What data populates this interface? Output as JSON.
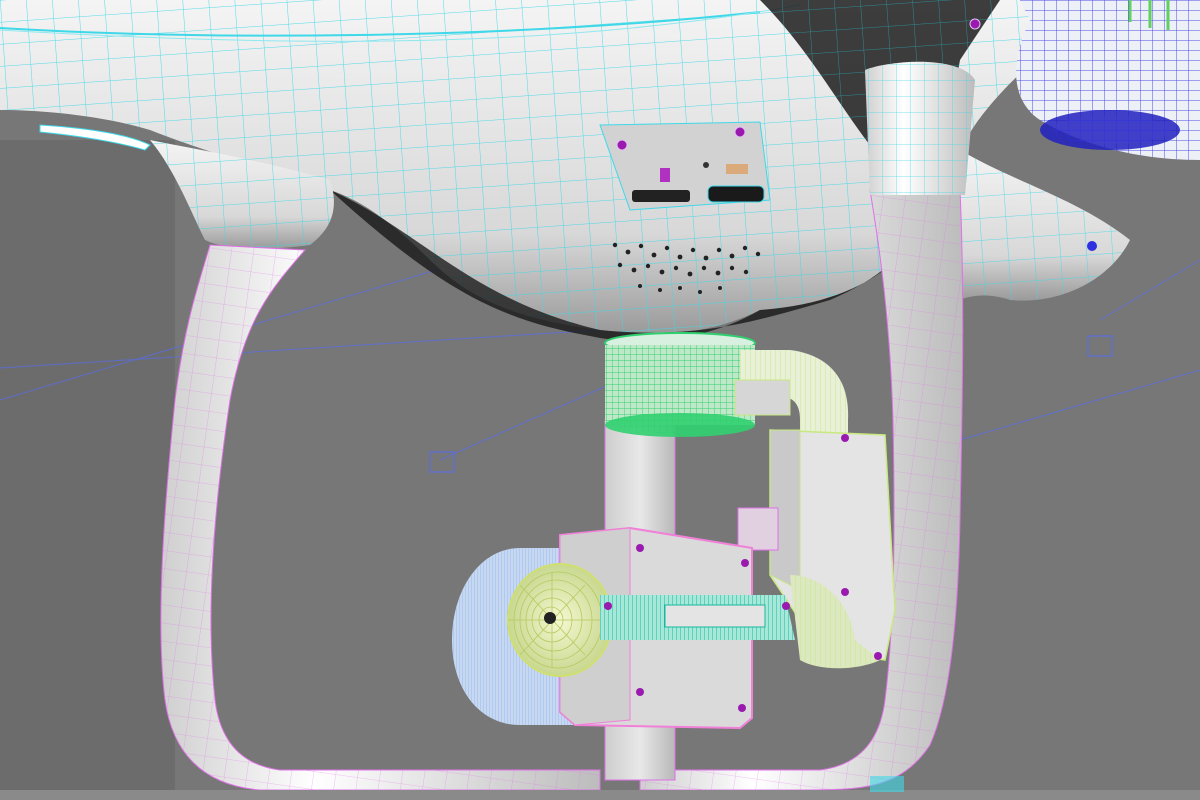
{
  "viewport": {
    "background": "#777777",
    "render_mode": "wireframe-on-shaded",
    "subject": "quadcopter-drone-underside-with-camera-gimbal",
    "wire_colors": {
      "body": "#3fd8e8",
      "legs": "#e070e8",
      "gimbal_mount": "#30d070",
      "gimbal_arm": "#c8e880",
      "camera_housing": "#f080d8",
      "lens_rear": "#90b8f0",
      "lens_front": "#e0f090",
      "rear_module": "#3030e0",
      "vertex_marker": "#9a1ab0"
    }
  }
}
